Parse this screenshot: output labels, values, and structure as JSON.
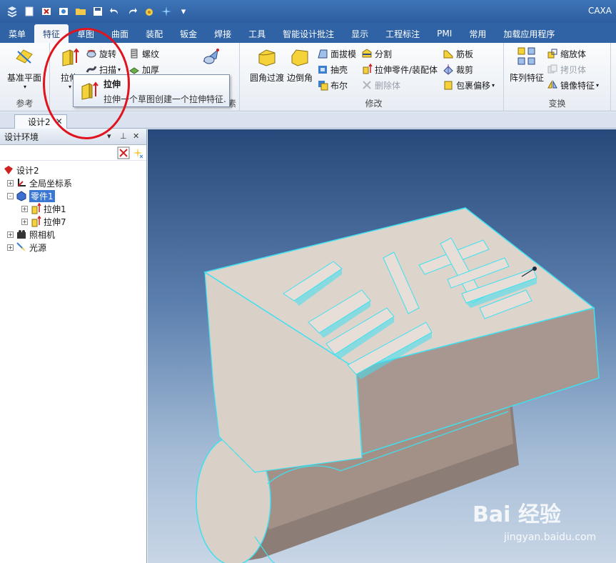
{
  "app": {
    "title": "CAXA"
  },
  "quick_access": [
    "app-icon",
    "new-icon",
    "open-icon",
    "print-icon",
    "folder-icon",
    "save-icon",
    "undo-icon",
    "redo-icon",
    "settings-icon",
    "sparkle-icon",
    "dropdown-icon"
  ],
  "tabs": [
    {
      "label": "菜单",
      "active": false
    },
    {
      "label": "特征",
      "active": true
    },
    {
      "label": "草图",
      "active": false
    },
    {
      "label": "曲面",
      "active": false
    },
    {
      "label": "装配",
      "active": false
    },
    {
      "label": "钣金",
      "active": false
    },
    {
      "label": "焊接",
      "active": false
    },
    {
      "label": "工具",
      "active": false
    },
    {
      "label": "智能设计批注",
      "active": false
    },
    {
      "label": "显示",
      "active": false
    },
    {
      "label": "工程标注",
      "active": false
    },
    {
      "label": "PMI",
      "active": false
    },
    {
      "label": "常用",
      "active": false
    },
    {
      "label": "加载应用程序",
      "active": false
    }
  ],
  "ribbon": {
    "ref_group": {
      "label": "参考",
      "datum_plane": "基准平面"
    },
    "feature_group": {
      "extrude": "拉伸",
      "revolve": "旋转",
      "sweep": "扫描",
      "thread": "螺纹",
      "thicken": "加厚",
      "label_tail": "素"
    },
    "modify_group": {
      "label": "修改",
      "fillet": "圆角过渡",
      "chamfer": "边倒角",
      "draft": "面拔模",
      "shell": "抽壳",
      "boolean": "布尔",
      "split": "分割",
      "extrude_to_part": "拉伸零件/装配体",
      "delete_body": "删除体",
      "rib": "筋板",
      "trim": "裁剪",
      "wrap_offset": "包裹偏移"
    },
    "transform_group": {
      "label": "变换",
      "pattern": "阵列特征",
      "scale": "缩放体",
      "copy": "拷贝体",
      "mirror": "镜像特征"
    }
  },
  "tooltip": {
    "title": "拉伸",
    "description": "拉伸一个草图创建一个拉伸特征."
  },
  "doc_tab": {
    "label": "设计2"
  },
  "panel": {
    "title": "设计环境",
    "tree": [
      {
        "label": "设计2",
        "level": 0,
        "expander": "",
        "selected": false
      },
      {
        "label": "全局坐标系",
        "level": 1,
        "expander": "+",
        "selected": false
      },
      {
        "label": "零件1",
        "level": 1,
        "expander": "-",
        "selected": true
      },
      {
        "label": "拉伸1",
        "level": 2,
        "expander": "+",
        "selected": false
      },
      {
        "label": "拉伸7",
        "level": 2,
        "expander": "+",
        "selected": false
      },
      {
        "label": "照相机",
        "level": 1,
        "expander": "+",
        "selected": false
      },
      {
        "label": "光源",
        "level": 1,
        "expander": "+",
        "selected": false
      }
    ]
  },
  "watermark": {
    "brand": "Bai 经验",
    "url": "jingyan.baidu.com"
  },
  "colors": {
    "accent": "#2f63a5",
    "highlight_circle": "#e0141e",
    "model_face": "#d9d0c8",
    "model_edge": "#3fe0f0"
  }
}
